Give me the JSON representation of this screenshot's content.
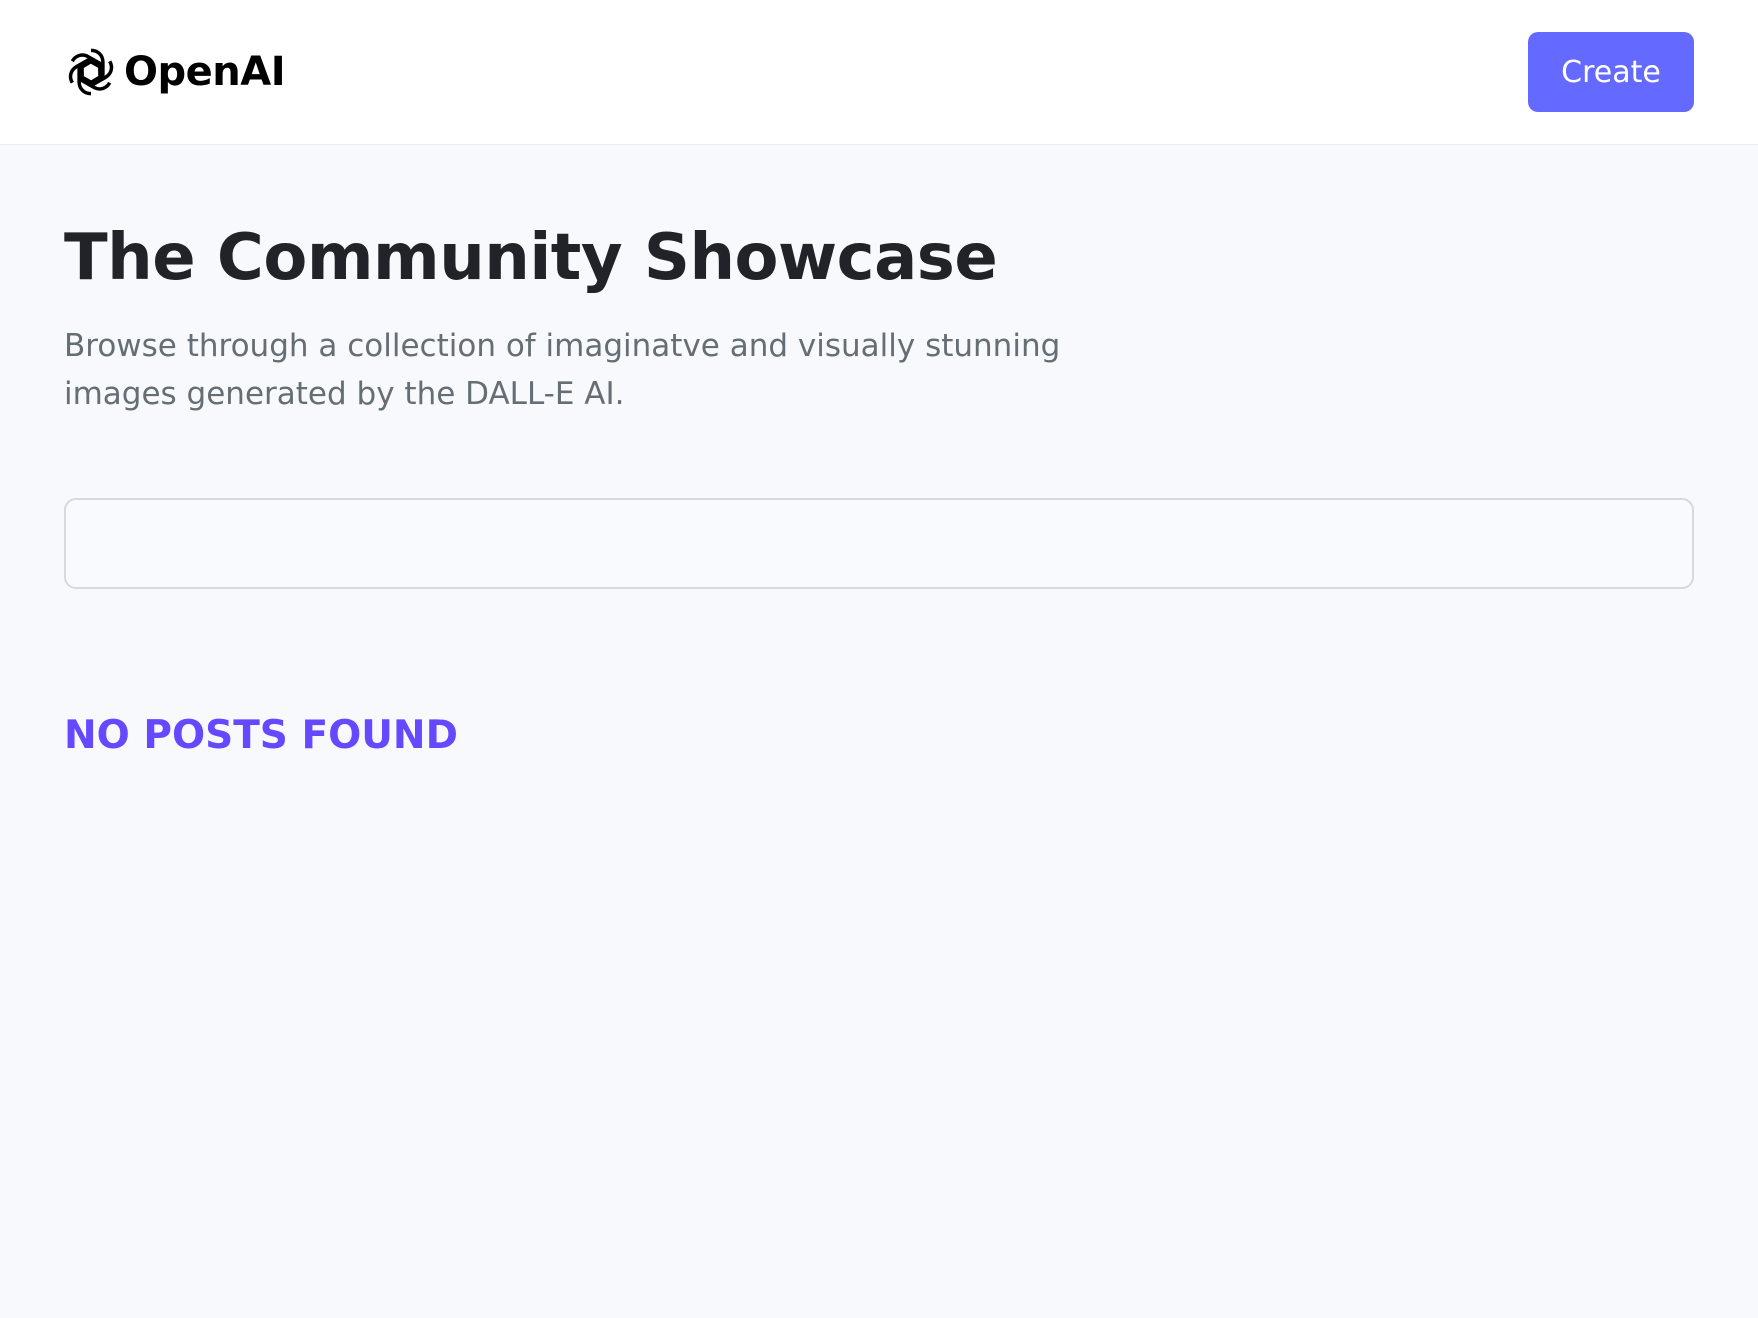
{
  "header": {
    "logo_text": "OpenAI",
    "logo_icon": "openai-logo-icon",
    "create_label": "Create"
  },
  "main": {
    "title": "The Community Showcase",
    "subtitle": "Browse through a collection of imaginatve and visually stunning images generated by the DALL-E AI.",
    "search": {
      "value": "",
      "placeholder": ""
    },
    "empty_message": "NO POSTS FOUND"
  },
  "colors": {
    "accent": "#6469ff",
    "empty_text": "#6449ff",
    "page_background": "#f8f9fd",
    "title": "#222328",
    "subtitle": "#666e75"
  }
}
